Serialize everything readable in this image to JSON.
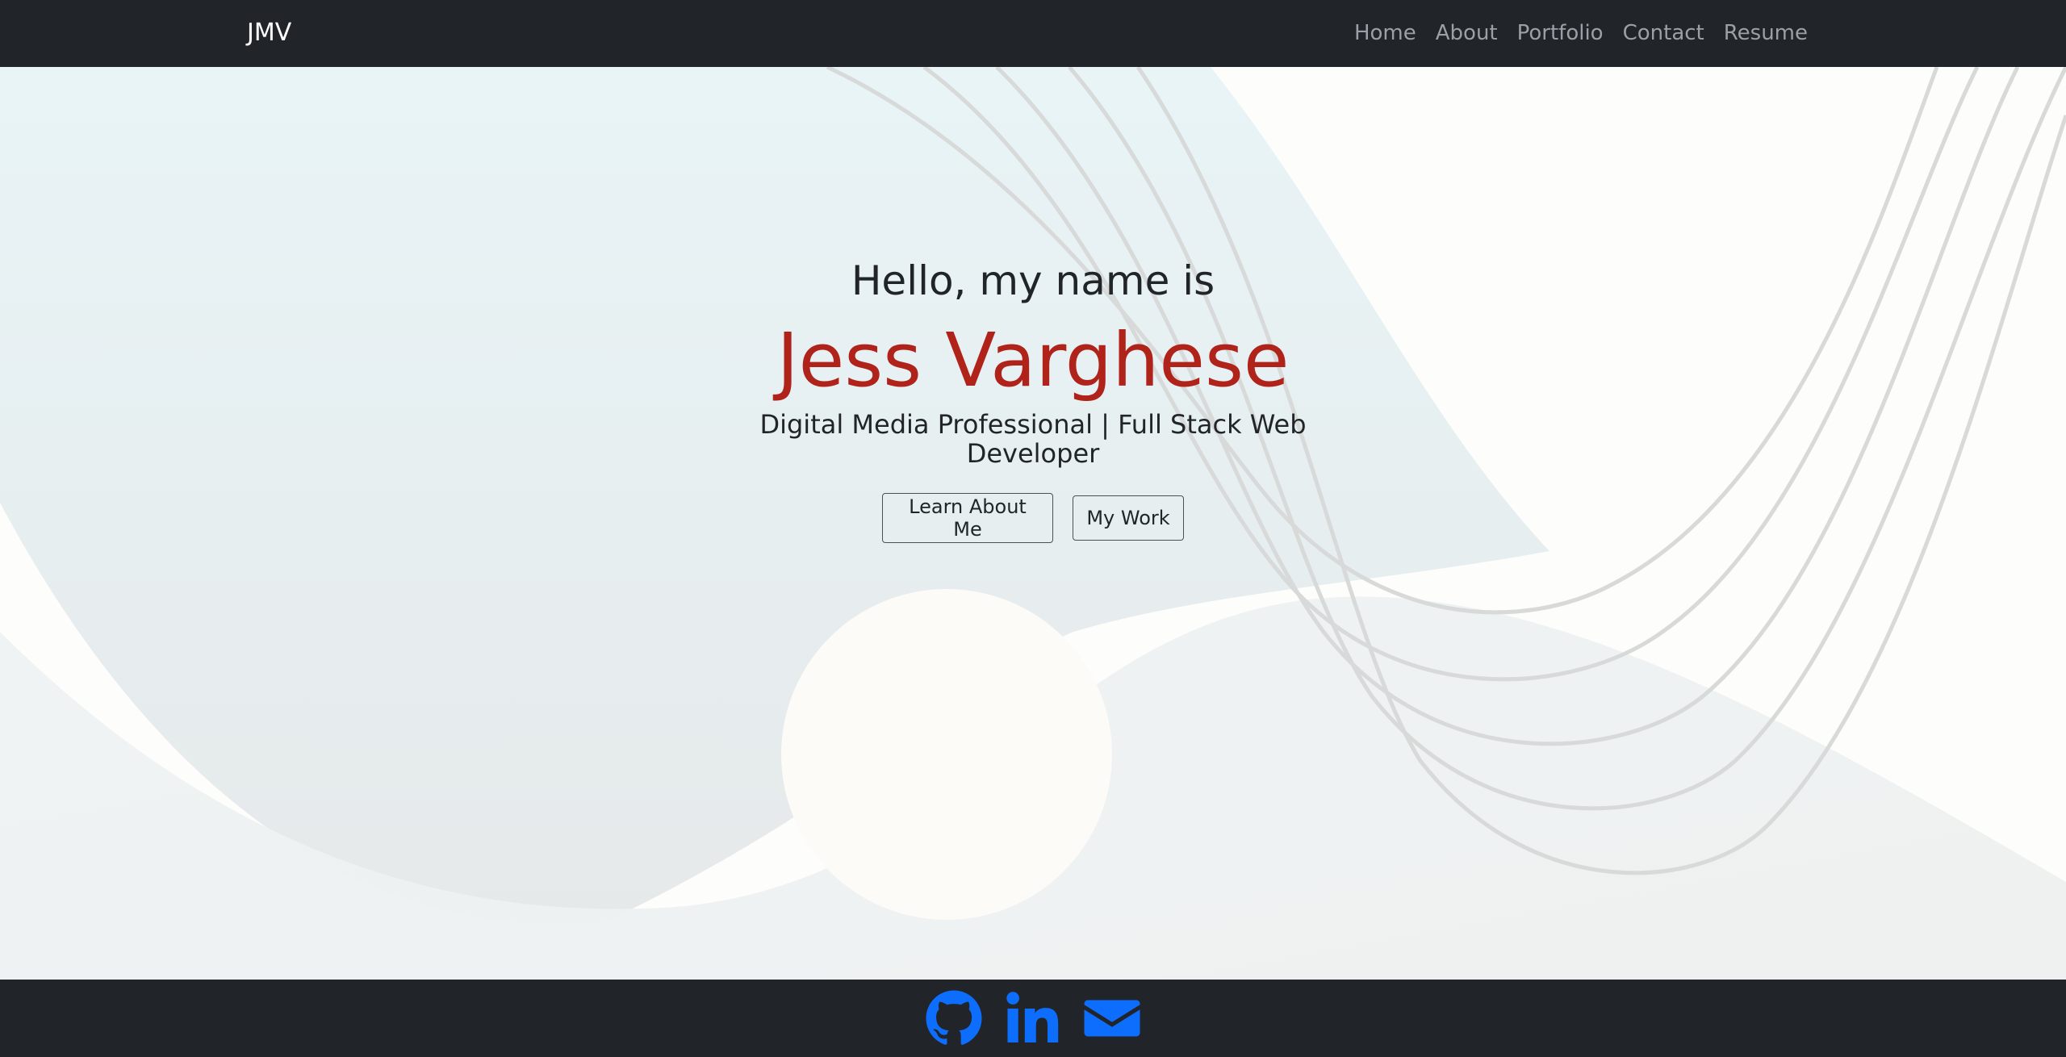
{
  "navbar": {
    "brand": "JMV",
    "links": [
      {
        "label": "Home"
      },
      {
        "label": "About"
      },
      {
        "label": "Portfolio"
      },
      {
        "label": "Contact"
      },
      {
        "label": "Resume"
      }
    ]
  },
  "hero": {
    "greeting": "Hello, my name is",
    "name": "Jess Varghese",
    "subtitle": "Digital Media Professional | Full Stack Web Developer",
    "buttons": {
      "learn_label": "Learn About Me",
      "work_label": "My Work"
    }
  },
  "footer": {
    "icons": [
      "github-icon",
      "linkedin-icon",
      "envelope-icon"
    ]
  },
  "colors": {
    "navbar_bg": "#212529",
    "name_accent": "#b0231a",
    "icon_blue": "#0d6efd",
    "hero_bg": "#fdfdfb"
  }
}
